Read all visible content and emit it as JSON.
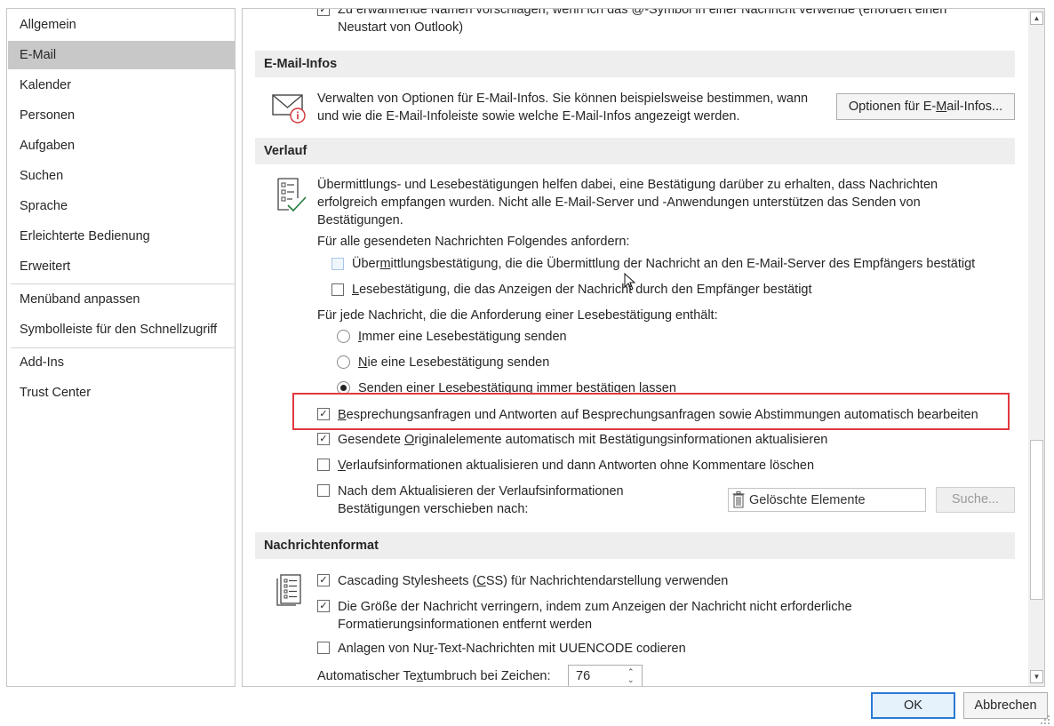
{
  "nav": {
    "items": [
      "Allgemein",
      "E-Mail",
      "Kalender",
      "Personen",
      "Aufgaben",
      "Suchen",
      "Sprache",
      "Erleichterte Bedienung",
      "Erweitert"
    ],
    "items2": [
      "Menüband anpassen",
      "Symbolleiste für den Schnellzugriff"
    ],
    "items3": [
      "Add-Ins",
      "Trust Center"
    ]
  },
  "top": {
    "line1": "Zu erwähnende Namen vorschlagen, wenn ich das @-Symbol in einer Nachricht verwende (erfordert einen",
    "line2": "Neustart von Outlook)"
  },
  "infos": {
    "header": "E-Mail-Infos",
    "desc1": "Verwalten von Optionen für E-Mail-Infos. Sie können beispielsweise bestimmen, wann",
    "desc2": "und wie die E-Mail-Infoleiste sowie welche E-Mail-Infos angezeigt werden.",
    "button_pre": "Optionen für E-",
    "button_u": "M",
    "button_post": "ail-Infos..."
  },
  "verlauf": {
    "header": "Verlauf",
    "desc1": "Übermittlungs- und Lesebestätigungen helfen dabei, eine Bestätigung darüber zu erhalten, dass Nachrichten",
    "desc2": "erfolgreich empfangen wurden. Nicht alle E-Mail-Server und -Anwendungen unterstützen das Senden von",
    "desc3": "Bestätigungen.",
    "request_label": "Für alle gesendeten Nachrichten Folgendes anfordern:",
    "opt1_pre": "Über",
    "opt1_u": "m",
    "opt1_post": "ittlungsbestätigung, die die Übermittlung der Nachricht an den E-Mail-Server des Empfängers bestätigt",
    "opt2_u": "L",
    "opt2_post": "esebestätigung, die das Anzeigen der Nachricht durch den Empfänger bestätigt",
    "each_label": "Für jede Nachricht, die die Anforderung einer Lesebestätigung enthält:",
    "radio1_u": "I",
    "radio1_post": "mmer eine Lesebestätigung senden",
    "radio2_u": "N",
    "radio2_post": "ie eine Lesebestätigung senden",
    "radio3_u": "S",
    "radio3_post": "enden einer Lesebestätigung immer bestätigen lassen",
    "chk1_u": "B",
    "chk1_post": "esprechungsanfragen und Antworten auf Besprechungsanfragen sowie Abstimmungen automatisch bearbeiten",
    "chk2_pre": "Gesendete ",
    "chk2_u": "O",
    "chk2_post": "riginalelemente automatisch mit Bestätigungsinformationen aktualisieren",
    "chk3_u": "V",
    "chk3_post": "erlaufsinformationen aktualisieren und dann Antworten ohne Kommentare löschen",
    "chk4_line1": "Nach dem Aktualisieren der Verlaufsinformationen",
    "chk4_line2": "Bestätigungen verschieben nach:",
    "folder_value": "Gelöschte Elemente",
    "browse_button": "Suche..."
  },
  "format": {
    "header": "Nachrichtenformat",
    "chk1_pre": "Cascading Stylesheets (",
    "chk1_u": "C",
    "chk1_post": "SS) für Nachrichtendarstellung verwenden",
    "chk2_line1": "Die Größe der Nachricht verringern, indem zum Anzeigen der Nachricht nicht erforderliche",
    "chk2_line2": "Formatierungsinformationen entfernt werden",
    "chk3_pre": "Anlagen von Nu",
    "chk3_u": "r",
    "chk3_post": "-Text-Nachrichten mit UUENCODE codieren",
    "wrap_pre": "Automatischer Te",
    "wrap_u": "x",
    "wrap_post": "tumbruch bei Zeichen:",
    "wrap_value": "76"
  },
  "footer": {
    "ok": "OK",
    "cancel": "Abbrechen"
  },
  "colors": {
    "highlight": "#e0393e",
    "selected_nav": "#c8c8c8",
    "section_bg": "#eeeeee"
  }
}
